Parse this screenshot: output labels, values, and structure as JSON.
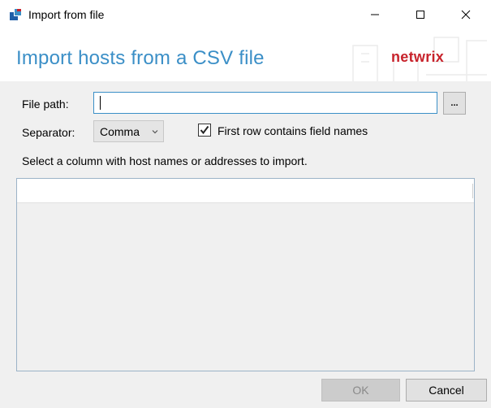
{
  "window": {
    "title": "Import from file",
    "controls": {
      "minimize": "minimize-icon",
      "maximize": "maximize-icon",
      "close": "close-icon"
    }
  },
  "header": {
    "title": "Import hosts from a CSV file",
    "logo": "netwrix"
  },
  "form": {
    "file_path_label": "File path:",
    "file_path_value": "",
    "browse_label": "...",
    "separator_label": "Separator:",
    "separator_value": "Comma",
    "first_row_label": "First row contains field names",
    "first_row_checked": true,
    "instruction": "Select a column with host names or addresses to import."
  },
  "buttons": {
    "ok": "OK",
    "cancel": "Cancel"
  },
  "colors": {
    "accent": "#3b8fc7",
    "logo": "#c8232c",
    "panel": "#f0f0f0"
  }
}
